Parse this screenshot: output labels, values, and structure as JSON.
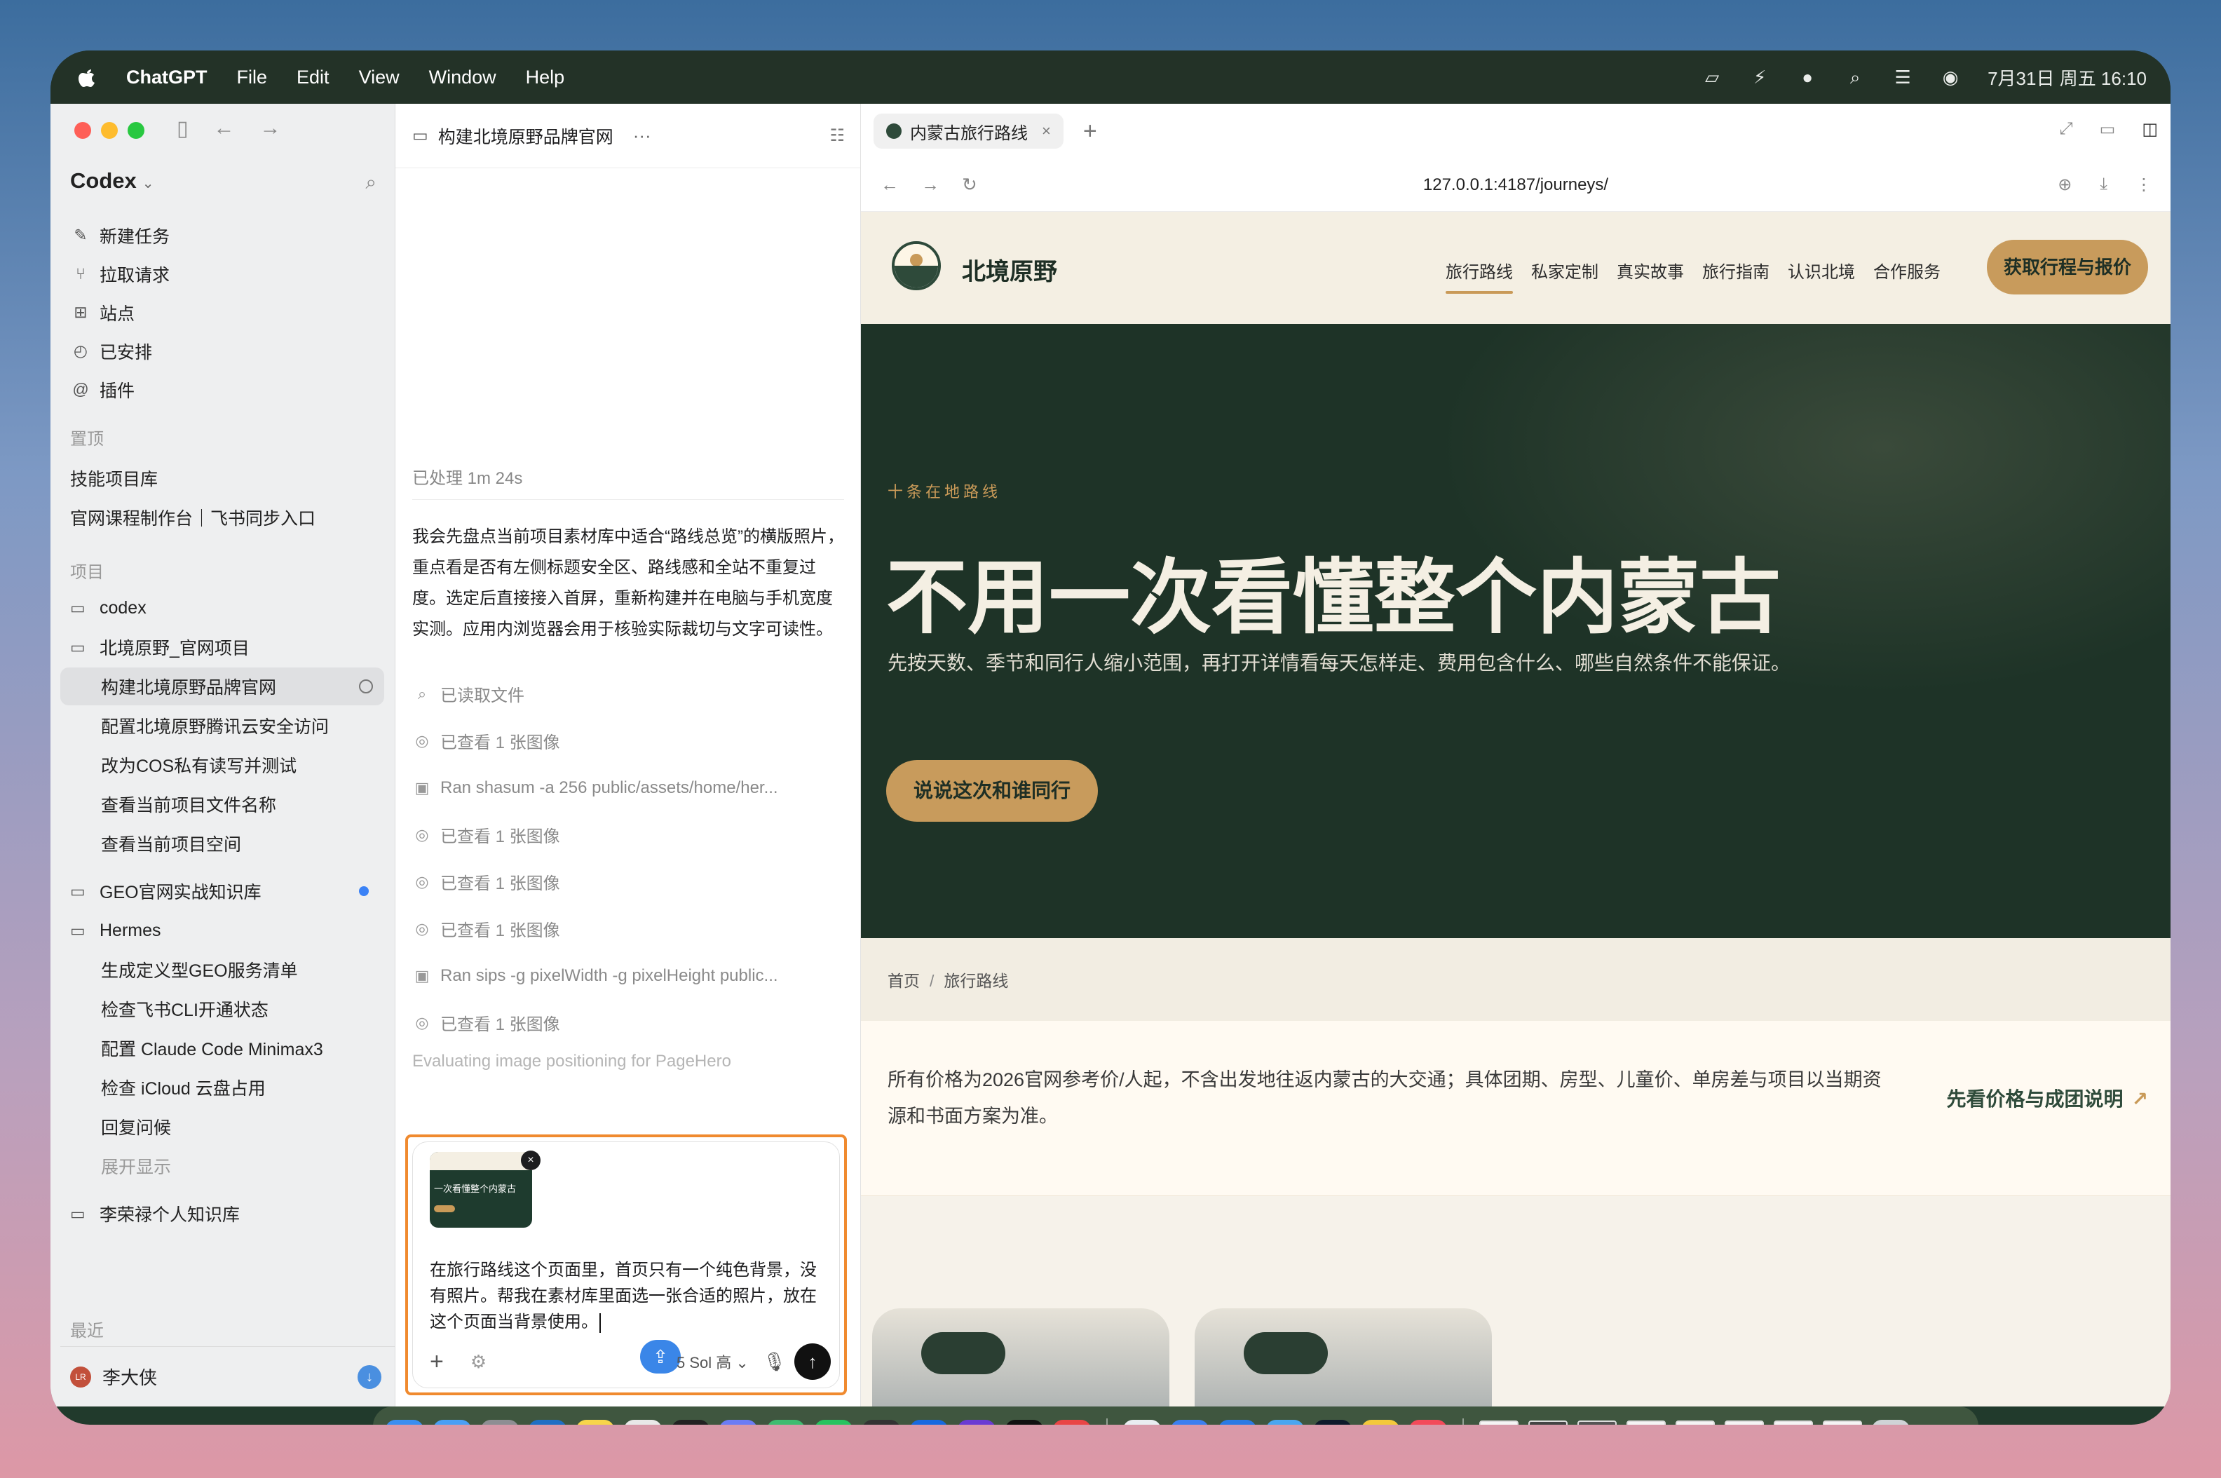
{
  "menubar": {
    "app_name": "ChatGPT",
    "menus": [
      "File",
      "Edit",
      "View",
      "Window",
      "Help"
    ],
    "clock": "7月31日 周五  16:10"
  },
  "sidebar": {
    "brand": "Codex",
    "nav": [
      {
        "label": "新建任务",
        "icon": "edit-icon"
      },
      {
        "label": "拉取请求",
        "icon": "pull-request-icon"
      },
      {
        "label": "站点",
        "icon": "sites-icon"
      },
      {
        "label": "已安排",
        "icon": "clock-icon"
      },
      {
        "label": "插件",
        "icon": "at-icon"
      }
    ],
    "pinned_label": "置顶",
    "pinned": [
      "技能项目库",
      "官网课程制作台｜飞书同步入口"
    ],
    "projects_label": "项目",
    "projects": {
      "codex": "codex",
      "beijing": "北境原野_官网项目",
      "beijing_tasks": [
        "构建北境原野品牌官网",
        "配置北境原野腾讯云安全访问",
        "改为COS私有读写并测试",
        "查看当前项目文件名称",
        "查看当前项目空间"
      ],
      "geo": "GEO官网实战知识库",
      "hermes": "Hermes",
      "hermes_tasks": [
        "生成定义型GEO服务清单",
        "检查飞书CLI开通状态",
        "配置 Claude Code Minimax3",
        "检查 iCloud 云盘占用",
        "回复问候"
      ],
      "expand": "展开显示",
      "personal": "李荣禄个人知识库"
    },
    "recent_label": "最近",
    "user": {
      "name": "李大侠",
      "initials": "LR"
    }
  },
  "chat": {
    "title": "构建北境原野品牌官网",
    "processed": "已处理 1m 24s",
    "message": "我会先盘点当前项目素材库中适合“路线总览”的横版照片，重点看是否有左侧标题安全区、路线感和全站不重复过度。选定后直接接入首屏，重新构建并在电脑与手机宽度实测。应用内浏览器会用于核验实际裁切与文字可读性。",
    "actions": [
      {
        "label": "已读取文件",
        "icon": "search-icon"
      },
      {
        "label": "已查看 1 张图像",
        "icon": "image-view-icon"
      },
      {
        "label": "Ran shasum -a 256 public/assets/home/her...",
        "icon": "terminal-icon"
      },
      {
        "label": "已查看 1 张图像",
        "icon": "image-view-icon"
      },
      {
        "label": "已查看 1 张图像",
        "icon": "image-view-icon"
      },
      {
        "label": "已查看 1 张图像",
        "icon": "image-view-icon"
      },
      {
        "label": "Ran sips -g pixelWidth -g pixelHeight public...",
        "icon": "terminal-icon"
      },
      {
        "label": "已查看 1 张图像",
        "icon": "image-view-icon"
      }
    ],
    "thinking": "Evaluating image positioning for PageHero",
    "composer": {
      "attachment_caption": "一次看懂整个内蒙古",
      "text": "在旅行路线这个页面里，首页只有一个纯色背景，没有照片。帮我在素材库里面选一张合适的照片，放在这个页面当背景使用。",
      "model": "5 Sol 高"
    }
  },
  "browser": {
    "tab_title": "内蒙古旅行路线",
    "url": "127.0.0.1:4187/journeys/"
  },
  "site": {
    "brand": "北境原野",
    "nav_links": [
      "旅行路线",
      "私家定制",
      "真实故事",
      "旅行指南",
      "认识北境",
      "合作服务"
    ],
    "cta": "获取行程与报价",
    "hero": {
      "eyebrow": "十条在地路线",
      "title": "不用一次看懂整个内蒙古",
      "desc": "先按天数、季节和同行人缩小范围，再打开详情看每天怎样走、费用包含什么、哪些自然条件不能保证。",
      "button": "说说这次和谁同行"
    },
    "breadcrumb": {
      "home": "首页",
      "sep": "/",
      "current": "旅行路线"
    },
    "notice": {
      "text": "所有价格为2026官网参考价/人起，不含出发地往返内蒙古的大交通；具体团期、房型、儿童价、单房差与项目以当期资源和书面方案为准。",
      "link": "先看价格与成团说明",
      "arrow": "↗"
    }
  },
  "colors": {
    "site_dark_green": "#1e3327",
    "site_gold": "#c89b5c",
    "site_cream": "#f4efe3",
    "composer_outline": "#f08a2f"
  }
}
